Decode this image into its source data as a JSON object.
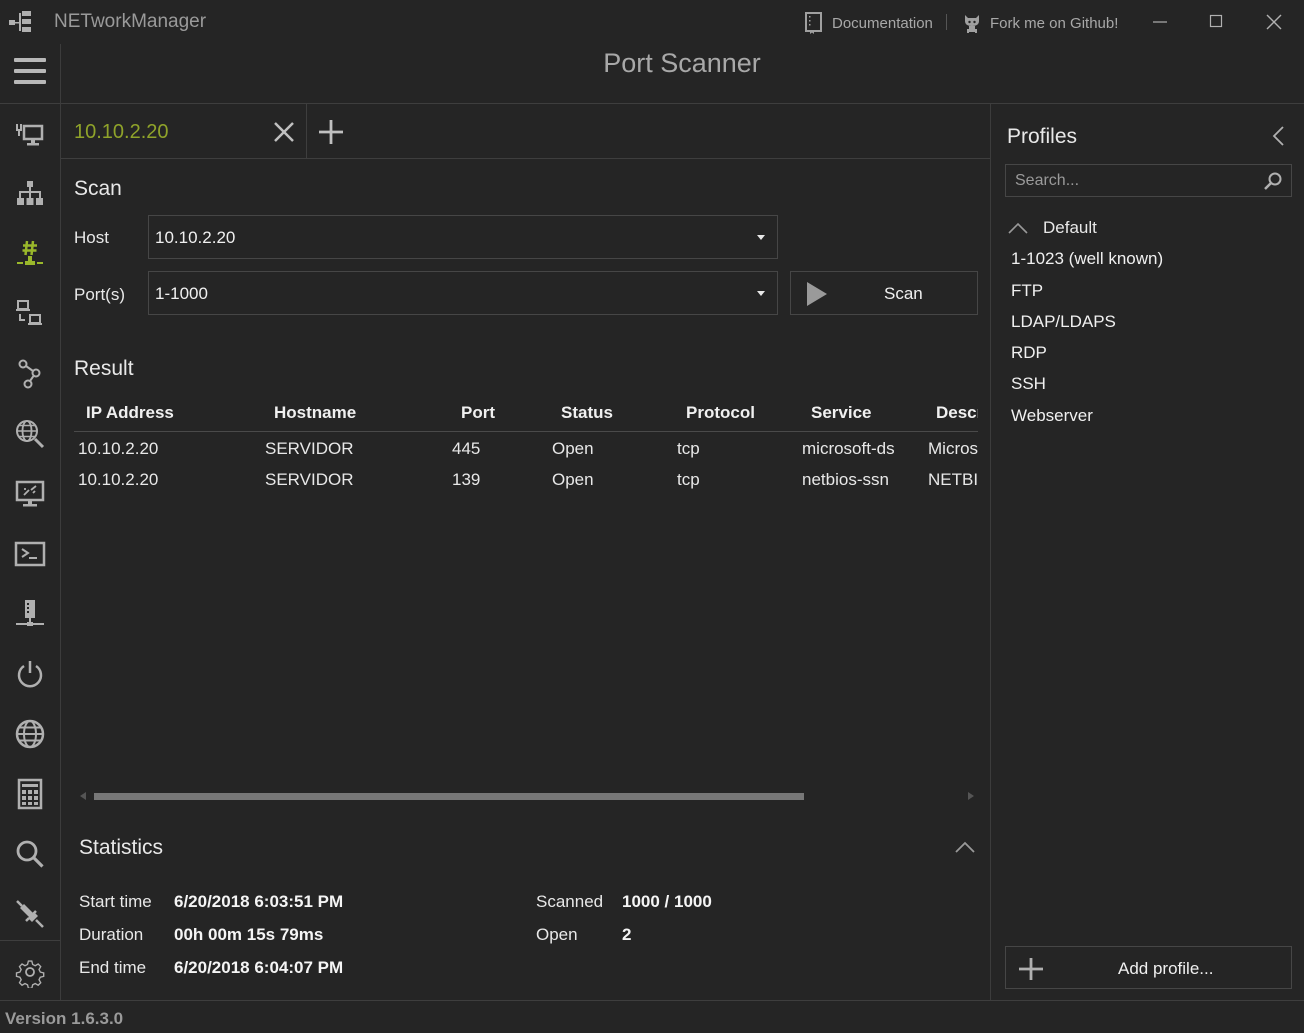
{
  "app": {
    "title": "NETworkManager",
    "version": "Version 1.6.3.0",
    "accent_color": "#8fa32a"
  },
  "titlebar": {
    "documentation_label": "Documentation",
    "github_label": "Fork me on Github!"
  },
  "header": {
    "page_title": "Port Scanner"
  },
  "sidebar": {
    "items": [
      {
        "icon": "network-interface-icon",
        "active": false
      },
      {
        "icon": "ip-scanner-icon",
        "active": false
      },
      {
        "icon": "port-scanner-icon",
        "active": true
      },
      {
        "icon": "remote-desktop-icon",
        "active": false
      },
      {
        "icon": "traceroute-icon",
        "active": false
      },
      {
        "icon": "dns-lookup-icon",
        "active": false
      },
      {
        "icon": "vnc-icon",
        "active": false
      },
      {
        "icon": "putty-icon",
        "active": false
      },
      {
        "icon": "snmp-icon",
        "active": false
      },
      {
        "icon": "wake-on-lan-icon",
        "active": false
      },
      {
        "icon": "http-headers-icon",
        "active": false
      },
      {
        "icon": "subnet-calculator-icon",
        "active": false
      },
      {
        "icon": "lookup-icon",
        "active": false
      },
      {
        "icon": "connections-icon",
        "active": false
      }
    ],
    "settings_icon": "gear-icon"
  },
  "tabs": [
    {
      "label": "10.10.2.20",
      "active": true
    }
  ],
  "scan": {
    "title": "Scan",
    "host_label": "Host",
    "host_value": "10.10.2.20",
    "ports_label": "Port(s)",
    "ports_value": "1-1000",
    "scan_button": "Scan"
  },
  "result": {
    "title": "Result",
    "columns": [
      "IP Address",
      "Hostname",
      "Port",
      "Status",
      "Protocol",
      "Service",
      "Descri"
    ],
    "rows": [
      {
        "ip": "10.10.2.20",
        "hostname": "SERVIDOR",
        "port": "445",
        "status": "Open",
        "protocol": "tcp",
        "service": "microsoft-ds",
        "description": "Micros"
      },
      {
        "ip": "10.10.2.20",
        "hostname": "SERVIDOR",
        "port": "139",
        "status": "Open",
        "protocol": "tcp",
        "service": "netbios-ssn",
        "description": "NETBIO"
      }
    ]
  },
  "statistics": {
    "title": "Statistics",
    "start_time_label": "Start time",
    "start_time": "6/20/2018 6:03:51 PM",
    "duration_label": "Duration",
    "duration": "00h 00m 15s 79ms",
    "end_time_label": "End time",
    "end_time": "6/20/2018 6:04:07 PM",
    "scanned_label": "Scanned",
    "scanned": "1000 / 1000",
    "open_label": "Open",
    "open": "2"
  },
  "profiles": {
    "title": "Profiles",
    "search_placeholder": "Search...",
    "group": "Default",
    "items": [
      "1-1023 (well known)",
      "FTP",
      "LDAP/LDAPS",
      "RDP",
      "SSH",
      "Webserver"
    ],
    "add_label": "Add profile..."
  }
}
